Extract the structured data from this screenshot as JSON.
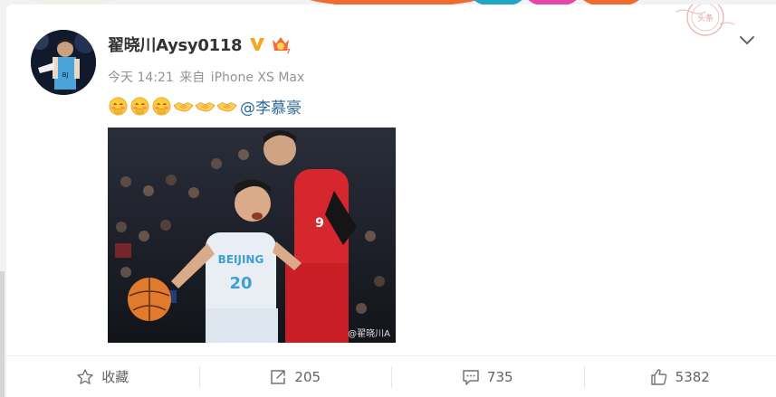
{
  "post": {
    "username": "翟晓川Aysy0118",
    "timestamp": "今天 14:21",
    "source_prefix": "来自",
    "source_device": "iPhone XS Max",
    "mention": "@李慕豪",
    "emojis": [
      "shy-face-emoji",
      "shy-face-emoji",
      "shy-face-emoji",
      "handshake-emoji",
      "handshake-emoji",
      "handshake-emoji"
    ],
    "photo": {
      "watermark": "@翟晓川A",
      "left_jersey_text": "BEIJING",
      "left_jersey_number": "20",
      "right_jersey_number": "9"
    }
  },
  "actions": {
    "favorite_label": "收藏",
    "repost_count": "205",
    "comment_count": "735",
    "like_count": "5382"
  },
  "icons": {
    "verified": "verified-v-icon",
    "vip": "vip-crown-icon",
    "menu": "chevron-down-icon",
    "favorite": "star-icon",
    "repost": "repost-icon",
    "comment": "comment-icon",
    "like": "thumbs-up-icon"
  },
  "colors": {
    "verified_gold": "#f5a623",
    "mention_blue": "#2b6a9a",
    "meta_gray": "#939393",
    "action_gray": "#636363"
  }
}
